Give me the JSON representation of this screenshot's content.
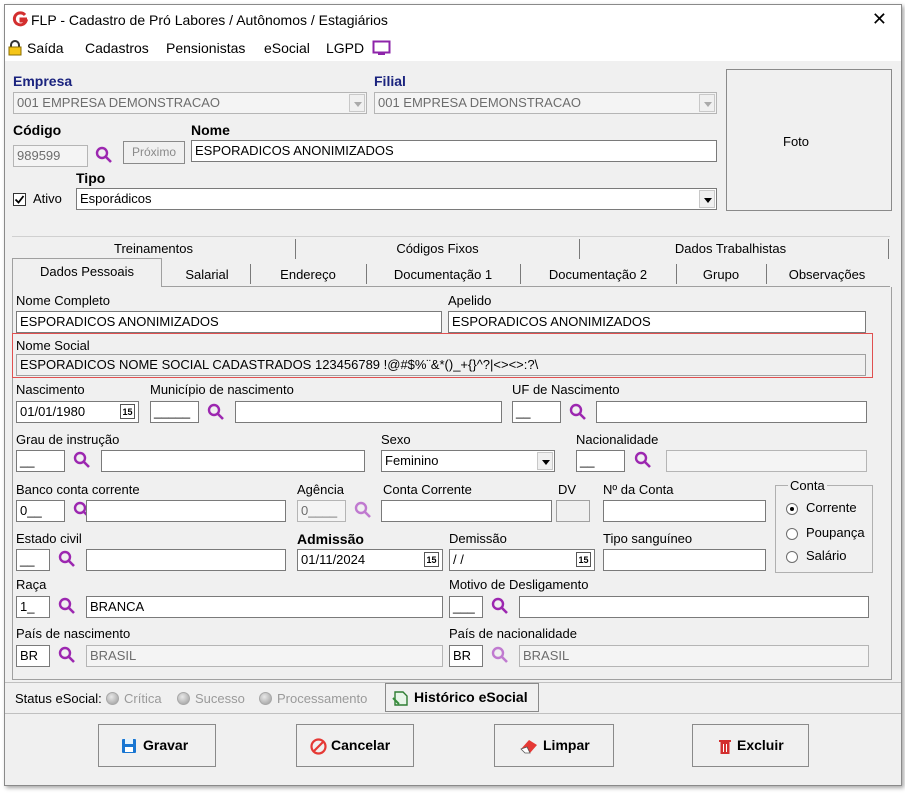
{
  "window": {
    "title": "FLP - Cadastro de Pró Labores / Autônomos / Estagiários"
  },
  "menu": {
    "exit": "Saída",
    "items": [
      "Cadastros",
      "Pensionistas",
      "eSocial",
      "LGPD"
    ]
  },
  "header": {
    "empresa_label": "Empresa",
    "empresa_value": "001 EMPRESA DEMONSTRACAO",
    "filial_label": "Filial",
    "filial_value": "001 EMPRESA DEMONSTRACAO",
    "codigo_label": "Código",
    "codigo_value": "989599",
    "proximo_label": "Próximo",
    "nome_label": "Nome",
    "nome_value": "ESPORADICOS ANONIMIZADOS",
    "ativo_label": "Ativo",
    "tipo_label": "Tipo",
    "tipo_value": "Esporádicos",
    "foto_label": "Foto"
  },
  "tabs_top": [
    "Treinamentos",
    "Códigos Fixos",
    "Dados Trabalhistas"
  ],
  "tabs_bottom": [
    "Dados Pessoais",
    "Salarial",
    "Endereço",
    "Documentação 1",
    "Documentação 2",
    "Grupo",
    "Observações"
  ],
  "form": {
    "nome_completo_label": "Nome Completo",
    "nome_completo_value": "ESPORADICOS ANONIMIZADOS",
    "apelido_label": "Apelido",
    "apelido_value": "ESPORADICOS ANONIMIZADOS",
    "nome_social_label": "Nome Social",
    "nome_social_value": "ESPORADICOS NOME SOCIAL CADASTRADOS 123456789 !@#$%¨&*()_+{}^?|<><>:?\\",
    "nascimento_label": "Nascimento",
    "nascimento_value": "01/01/1980",
    "municipio_label": "Município de nascimento",
    "municipio_code": "_____",
    "uf_label": "UF de Nascimento",
    "uf_code": "__",
    "grau_label": "Grau de instrução",
    "grau_code": "__",
    "sexo_label": "Sexo",
    "sexo_value": "Feminino",
    "nacionalidade_label": "Nacionalidade",
    "nacionalidade_code": "__",
    "banco_label": "Banco conta corrente",
    "banco_code": "0__",
    "agencia_label": "Agência",
    "agencia_code": "0____",
    "conta_corrente_label": "Conta Corrente",
    "dv_label": "DV",
    "num_conta_label": "Nº da Conta",
    "conta_group_label": "Conta",
    "conta_options": [
      "Corrente",
      "Poupança",
      "Salário"
    ],
    "estado_civil_label": "Estado civil",
    "estado_civil_code": "__",
    "admissao_label": "Admissão",
    "admissao_value": "01/11/2024",
    "demissao_label": "Demissão",
    "demissao_value": " / /",
    "tipo_sanguineo_label": "Tipo sanguíneo",
    "raca_label": "Raça",
    "raca_code": "1_",
    "raca_value": "BRANCA",
    "motivo_label": "Motivo de Desligamento",
    "motivo_code": "___",
    "pais_nasc_label": "País de nascimento",
    "pais_nasc_code": "BR",
    "pais_nasc_value": "BRASIL",
    "pais_nac_label": "País de nacionalidade",
    "pais_nac_code": "BR",
    "pais_nac_value": "BRASIL",
    "cal_glyph": "15"
  },
  "status": {
    "label": "Status eSocial:",
    "items": [
      "Crítica",
      "Sucesso",
      "Processamento"
    ],
    "historico": "Histórico eSocial"
  },
  "buttons": {
    "gravar": "Gravar",
    "cancelar": "Cancelar",
    "limpar": "Limpar",
    "excluir": "Excluir"
  },
  "colors": {
    "label_navy": "#1a237e",
    "highlight_red": "#e05050",
    "magnifier": "#9c27b0",
    "lgpd_icon": "#8e24aa"
  }
}
